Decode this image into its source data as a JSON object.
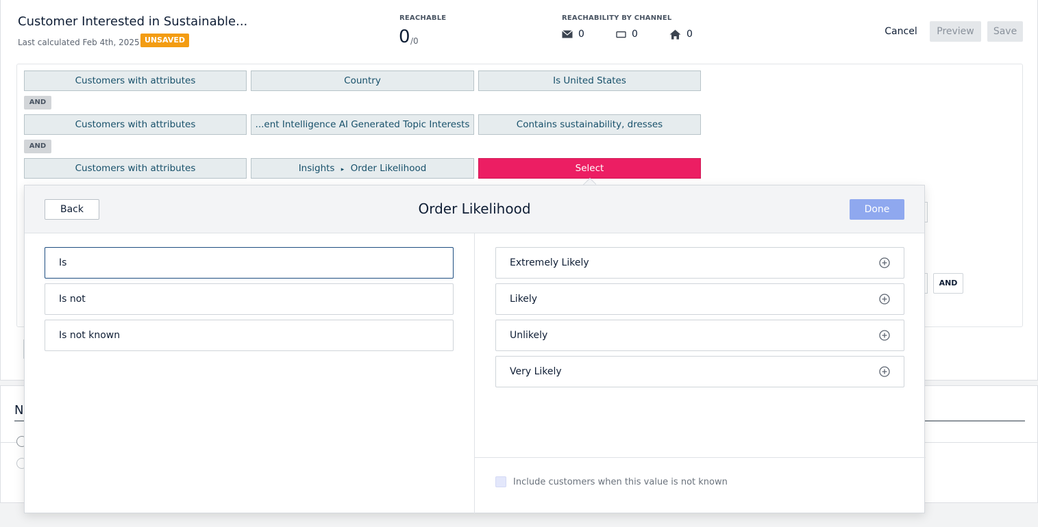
{
  "header": {
    "title": "Customer Interested in Sustainable...",
    "last_calculated": "Last calculated Feb 4th, 2025",
    "status_badge": "UNSAVED",
    "reachable_label": "REACHABLE",
    "reachable_value": "0",
    "reachable_total": "/0",
    "channel_label": "REACHABILITY BY CHANNEL",
    "channels": [
      {
        "icon": "envelope-icon",
        "count": "0"
      },
      {
        "icon": "device-icon",
        "count": "0"
      },
      {
        "icon": "home-icon",
        "count": "0"
      }
    ],
    "cancel_label": "Cancel",
    "preview_label": "Preview",
    "save_label": "Save"
  },
  "rules": [
    {
      "type": "Customers with attributes",
      "attribute": "Country",
      "value": "Is United States"
    },
    {
      "type": "Customers with attributes",
      "attribute": "...ent Intelligence AI Generated Topic Interests",
      "value": "Contains sustainability, dresses"
    },
    {
      "type": "Customers with attributes",
      "attribute_parent": "Insights",
      "attribute_separator": "▸",
      "attribute_child": "Order Likelihood",
      "value": "Select"
    }
  ],
  "connectors": [
    "AND",
    "AND"
  ],
  "background_and_label": "AND",
  "lower_section": {
    "heading_fragment": "N"
  },
  "modal": {
    "title": "Order Likelihood",
    "back_label": "Back",
    "done_label": "Done",
    "operators": [
      {
        "label": "Is",
        "selected": true
      },
      {
        "label": "Is not",
        "selected": false
      },
      {
        "label": "Is not known",
        "selected": false
      }
    ],
    "values": [
      {
        "label": "Extremely Likely",
        "icon": "plus-circle-icon"
      },
      {
        "label": "Likely",
        "icon": "plus-circle-icon"
      },
      {
        "label": "Unlikely",
        "icon": "plus-circle-icon"
      },
      {
        "label": "Very Likely",
        "icon": "plus-circle-icon"
      }
    ],
    "include_unknown_label": "Include customers when this value is not known",
    "include_unknown_checked": false
  },
  "colors": {
    "accent_select": "#ec1e63",
    "done_button": "#8fa8ef",
    "unsaved_badge": "#f39c12"
  }
}
